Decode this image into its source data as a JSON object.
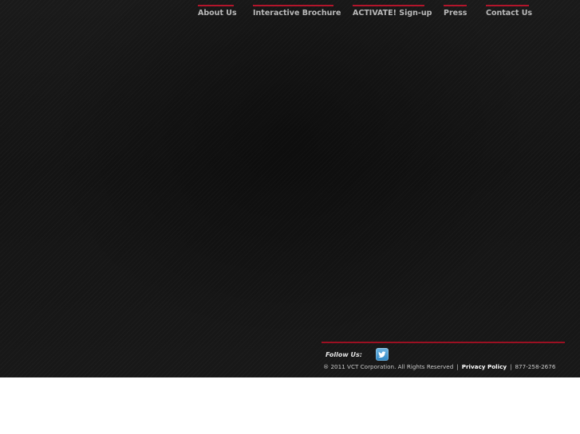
{
  "nav": {
    "items": [
      {
        "label": "About Us"
      },
      {
        "label": "Interactive Brochure"
      },
      {
        "label": "ACTIVATE! Sign-up"
      },
      {
        "label": "Press"
      },
      {
        "label": "Contact Us"
      }
    ],
    "accent_color": "#b3152b"
  },
  "footer": {
    "follow_label": "Follow Us:",
    "social_icon": "twitter-icon",
    "copyright": "® 2011 VCT Corporation. All Rights Reserved",
    "separator": "|",
    "privacy_label": "Privacy Policy",
    "phone": "877-258-2676",
    "accent_color": "#9b1022"
  }
}
